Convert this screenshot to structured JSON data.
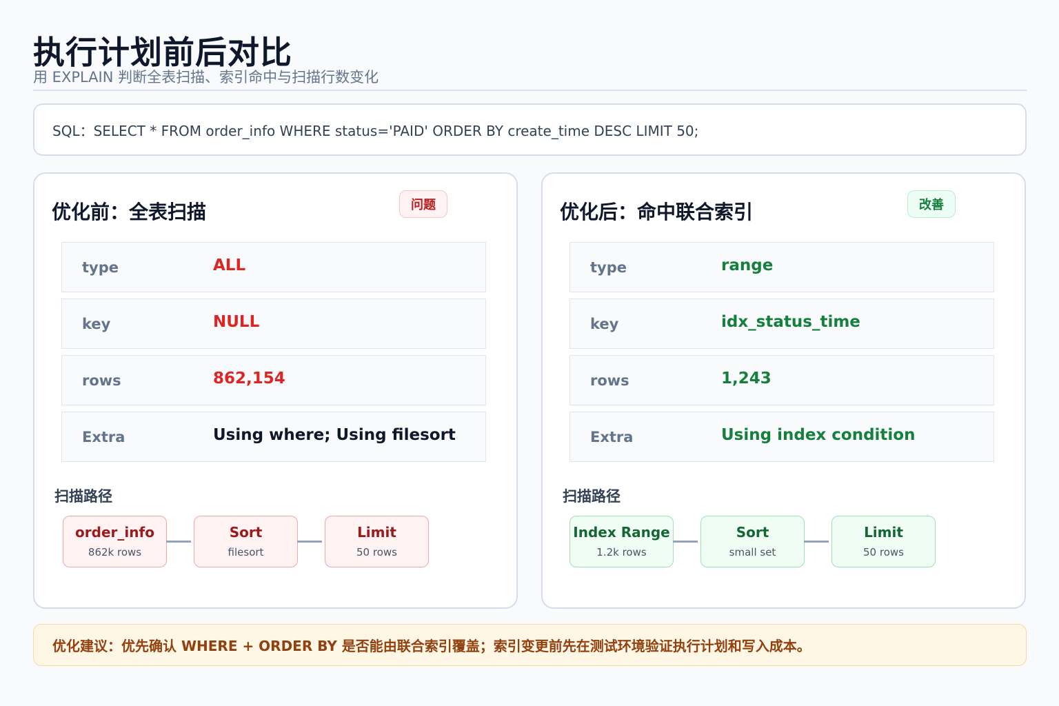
{
  "header": {
    "title": "执行计划前后对比",
    "subtitle": "用 EXPLAIN 判断全表扫描、索引命中与扫描行数变化"
  },
  "sql": "SQL：SELECT * FROM order_info WHERE status='PAID' ORDER BY create_time DESC LIMIT 50;",
  "before": {
    "title": "优化前：全表扫描",
    "badge": "问题",
    "rows": [
      {
        "key": "type",
        "value": "ALL"
      },
      {
        "key": "key",
        "value": "NULL"
      },
      {
        "key": "rows",
        "value": "862,154"
      },
      {
        "key": "Extra",
        "value": "Using where; Using filesort"
      }
    ],
    "path_label": "扫描路径",
    "path": [
      {
        "title": "order_info",
        "sub": "862k rows"
      },
      {
        "title": "Sort",
        "sub": "filesort"
      },
      {
        "title": "Limit",
        "sub": "50 rows"
      }
    ]
  },
  "after": {
    "title": "优化后：命中联合索引",
    "badge": "改善",
    "rows": [
      {
        "key": "type",
        "value": "range"
      },
      {
        "key": "key",
        "value": "idx_status_time"
      },
      {
        "key": "rows",
        "value": "1,243"
      },
      {
        "key": "Extra",
        "value": "Using index condition"
      }
    ],
    "path_label": "扫描路径",
    "path": [
      {
        "title": "Index Range",
        "sub": "1.2k rows"
      },
      {
        "title": "Sort",
        "sub": "small set"
      },
      {
        "title": "Limit",
        "sub": "50 rows"
      }
    ]
  },
  "advice": "优化建议：优先确认 WHERE + ORDER BY 是否能由联合索引覆盖；索引变更前先在测试环境验证执行计划和写入成本。",
  "colors": {
    "bad": "#dc2626",
    "good": "#15803d",
    "advice_bg": "#fff7e6"
  }
}
